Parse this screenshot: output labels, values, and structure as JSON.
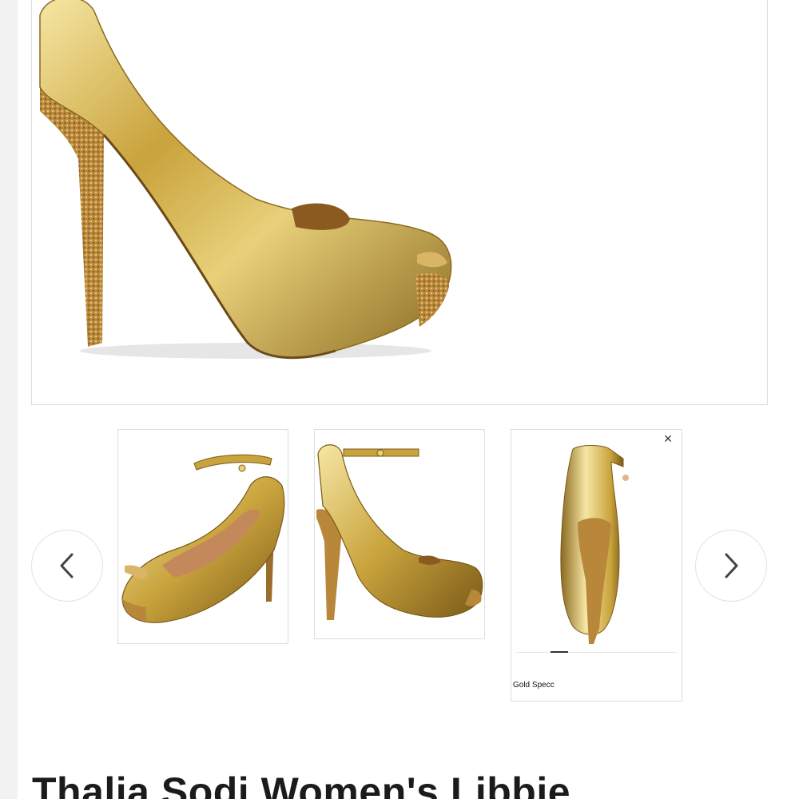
{
  "gallery": {
    "main_image_alt": "",
    "prev_icon": "chevron-left-icon",
    "next_icon": "chevron-right-icon",
    "thumbnails": [
      {
        "view": "front-three-quarter"
      },
      {
        "view": "side"
      },
      {
        "view": "back"
      }
    ]
  },
  "swatch_popup": {
    "close_symbol": "×",
    "label": "Gold Specc"
  },
  "product": {
    "title": "Thalia Sodi Women's Libbie"
  },
  "colors": {
    "gold_light": "#f4e29a",
    "gold_mid": "#c9a33c",
    "gold_dark": "#7a5a18",
    "heel_glitter": "#b8873a",
    "border": "#dcdcdc"
  }
}
